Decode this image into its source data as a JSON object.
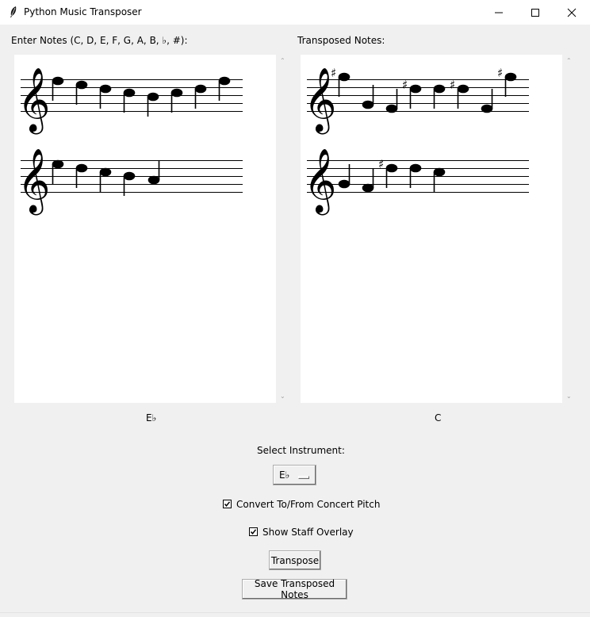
{
  "window": {
    "title": "Python Music Transposer",
    "icon": "feather-icon"
  },
  "left_panel": {
    "label": "Enter Notes (C, D, E, F, G, A, B, ♭, #):",
    "key_label": "E♭"
  },
  "right_panel": {
    "label": "Transposed Notes:",
    "key_label": "C"
  },
  "controls": {
    "instrument_label": "Select Instrument:",
    "instrument_value": "E♭",
    "concert_pitch_label": "Convert To/From Concert Pitch",
    "concert_pitch_checked": true,
    "staff_overlay_label": "Show Staff Overlay",
    "staff_overlay_checked": true,
    "transpose_label": "Transpose",
    "save_label": "Save Transposed Notes"
  },
  "colors": {
    "background": "#f0f0f0",
    "canvas": "#ffffff",
    "ink": "#000000"
  }
}
